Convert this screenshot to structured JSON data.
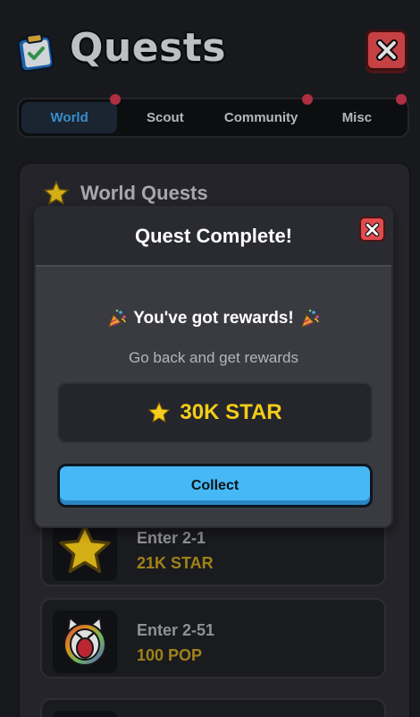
{
  "header": {
    "title": "Quests",
    "icon": "clipboard-check-icon",
    "close_icon": "close-icon"
  },
  "tabs": [
    {
      "label": "World",
      "active": true,
      "notification": true
    },
    {
      "label": "Scout",
      "active": false,
      "notification": false
    },
    {
      "label": "Community",
      "active": false,
      "notification": true
    },
    {
      "label": "Misc",
      "active": false,
      "notification": true
    }
  ],
  "panel": {
    "title": "World Quests",
    "icon": "star-icon",
    "quests": [
      {
        "name": "Enter 2-1",
        "reward": "21K STAR",
        "icon": "star-icon"
      },
      {
        "name": "Enter 2-51",
        "reward": "100 POP",
        "icon": "cat-character-icon"
      }
    ]
  },
  "modal": {
    "title": "Quest Complete!",
    "reward_heading": "You've got rewards!",
    "subtext": "Go back and get rewards",
    "reward": "30K STAR",
    "collect_label": "Collect"
  },
  "colors": {
    "accent_blue": "#46b8f5",
    "tab_active_text": "#3fa3e6",
    "reward_gold": "#f5cc18",
    "close_red": "#e24b4e",
    "notification_dot": "#c8354a"
  }
}
